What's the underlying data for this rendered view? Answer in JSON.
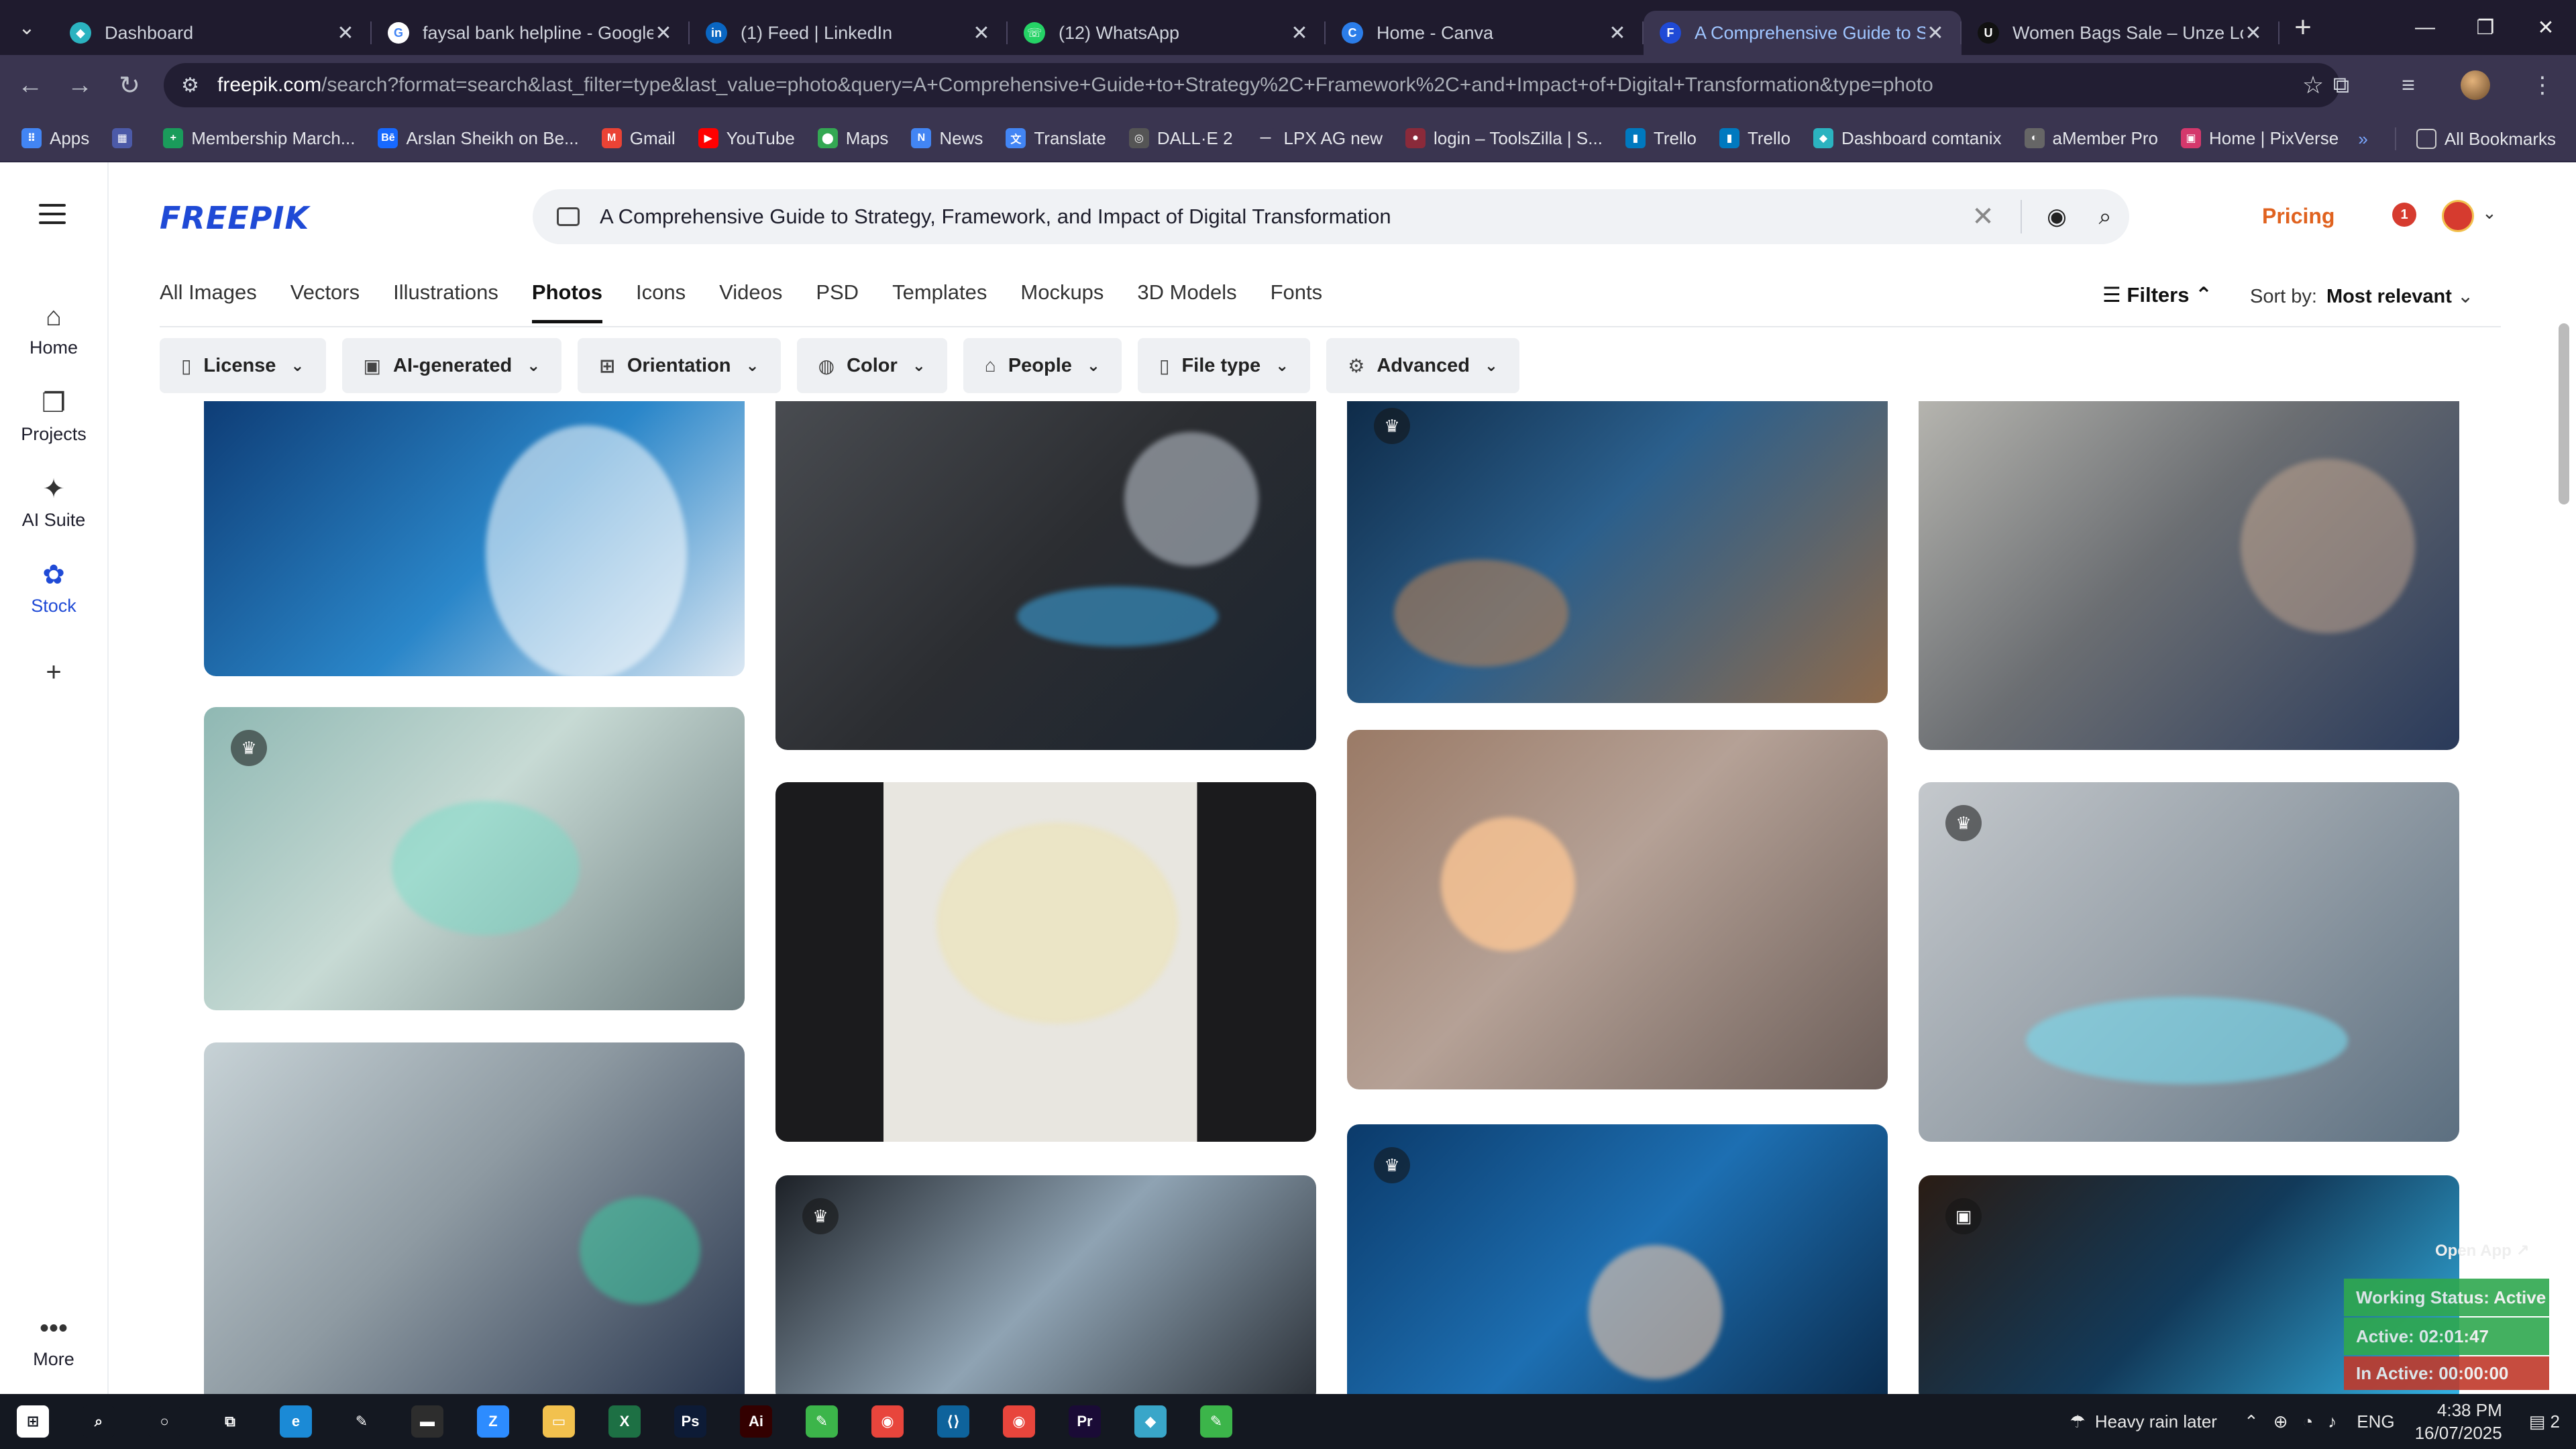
{
  "browser": {
    "tabs": [
      {
        "title": "Dashboard",
        "color": "#2bb3c0",
        "glyph": "◆"
      },
      {
        "title": "faysal bank helpline - Google S",
        "color": "#ffffff",
        "glyph": "G"
      },
      {
        "title": "(1) Feed | LinkedIn",
        "color": "#0a66c2",
        "glyph": "in"
      },
      {
        "title": "(12) WhatsApp",
        "color": "#25d366",
        "glyph": "☏"
      },
      {
        "title": "Home - Canva",
        "color": "#2b7de9",
        "glyph": "C"
      },
      {
        "title": "A Comprehensive Guide to Stra",
        "color": "#1f4ad6",
        "glyph": "F"
      },
      {
        "title": "Women Bags Sale – Unze Lond",
        "color": "#111111",
        "glyph": "U"
      }
    ],
    "url_host": "freepik.com",
    "url_rest": "/search?format=search&last_filter=type&last_value=photo&query=A+Comprehensive+Guide+to+Strategy%2C+Framework%2C+and+Impact+of+Digital+Transformation&type=photo",
    "bookmarks": [
      {
        "label": "Apps",
        "color": "#4285f4",
        "glyph": "⠿"
      },
      {
        "label": "",
        "color": "#4c5aa8",
        "glyph": "▦"
      },
      {
        "label": "Membership March...",
        "color": "#1a9c5b",
        "glyph": "+"
      },
      {
        "label": "Arslan Sheikh on Be...",
        "color": "#1769ff",
        "glyph": "Bē"
      },
      {
        "label": "Gmail",
        "color": "#ea4335",
        "glyph": "M"
      },
      {
        "label": "YouTube",
        "color": "#ff0000",
        "glyph": "▶"
      },
      {
        "label": "Maps",
        "color": "#34a853",
        "glyph": "⬤"
      },
      {
        "label": "News",
        "color": "#4285f4",
        "glyph": "N"
      },
      {
        "label": "Translate",
        "color": "#4285f4",
        "glyph": "文"
      },
      {
        "label": "DALL·E 2",
        "color": "#555555",
        "glyph": "◎"
      },
      {
        "label": "LPX AG new",
        "color": "#3a3550",
        "glyph": "—"
      },
      {
        "label": "login – ToolsZilla | S...",
        "color": "#8a2a3a",
        "glyph": "●"
      },
      {
        "label": "Trello",
        "color": "#0079bf",
        "glyph": "▮"
      },
      {
        "label": "Trello",
        "color": "#0079bf",
        "glyph": "▮"
      },
      {
        "label": "Dashboard comtanix",
        "color": "#2bb3c0",
        "glyph": "◆"
      },
      {
        "label": "aMember Pro",
        "color": "#666666",
        "glyph": "◐"
      },
      {
        "label": "Home | PixVerse",
        "color": "#d4386c",
        "glyph": "▣"
      }
    ],
    "all_bookmarks": "All Bookmarks"
  },
  "freepik": {
    "logo": "FREEPIK",
    "search_query": "A Comprehensive Guide to Strategy, Framework, and Impact of Digital Transformation",
    "pricing": "Pricing",
    "notif_count": "1",
    "nav": [
      {
        "label": "Home",
        "icon": "⌂"
      },
      {
        "label": "Projects",
        "icon": "❐"
      },
      {
        "label": "AI Suite",
        "icon": "✦"
      },
      {
        "label": "Stock",
        "icon": "✿"
      },
      {
        "label": "",
        "icon": "+"
      },
      {
        "label": "More",
        "icon": "•••"
      }
    ],
    "categories": [
      "All Images",
      "Vectors",
      "Illustrations",
      "Photos",
      "Icons",
      "Videos",
      "PSD",
      "Templates",
      "Mockups",
      "3D Models",
      "Fonts"
    ],
    "active_category": "Photos",
    "filters_label": "Filters",
    "sort_label": "Sort by:",
    "sort_value": "Most relevant",
    "chips": [
      {
        "label": "License",
        "icon": "▯"
      },
      {
        "label": "AI-generated",
        "icon": "▣"
      },
      {
        "label": "Orientation",
        "icon": "⊞"
      },
      {
        "label": "Color",
        "icon": "◍"
      },
      {
        "label": "People",
        "icon": "⌂"
      },
      {
        "label": "File type",
        "icon": "▯"
      },
      {
        "label": "Advanced",
        "icon": "⚙"
      }
    ]
  },
  "overlay": {
    "open_app": "Open App ↗",
    "status": "Working Status: Active",
    "active": "Active: 02:01:47",
    "inactive": "In Active: 00:00:00",
    "status_color": "#2fa84f",
    "inactive_color": "#c0392b"
  },
  "taskbar": {
    "weather": "Heavy rain later",
    "lang": "ENG",
    "time": "4:38 PM",
    "date": "16/07/2025",
    "notif": "2",
    "apps": [
      {
        "name": "windows",
        "color": "#ffffff",
        "glyph": "⊞"
      },
      {
        "name": "search",
        "color": "#141821",
        "glyph": "⌕"
      },
      {
        "name": "cortana",
        "color": "#141821",
        "glyph": "○"
      },
      {
        "name": "taskview",
        "color": "#141821",
        "glyph": "⧉"
      },
      {
        "name": "edge",
        "color": "#1b8ad6",
        "glyph": "e"
      },
      {
        "name": "pen",
        "color": "#141821",
        "glyph": "✎"
      },
      {
        "name": "terminal",
        "color": "#2d2d2d",
        "glyph": "▬"
      },
      {
        "name": "zoom",
        "color": "#2d8cff",
        "glyph": "Z"
      },
      {
        "name": "explorer",
        "color": "#f2c14e",
        "glyph": "▭"
      },
      {
        "name": "excel",
        "color": "#1d7044",
        "glyph": "X"
      },
      {
        "name": "photoshop",
        "color": "#0d1b36",
        "glyph": "Ps"
      },
      {
        "name": "illustrator",
        "color": "#330000",
        "glyph": "Ai"
      },
      {
        "name": "app-green",
        "color": "#3cb54a",
        "glyph": "✎"
      },
      {
        "name": "chrome",
        "color": "#e8453c",
        "glyph": "◉"
      },
      {
        "name": "vscode",
        "color": "#0e639c",
        "glyph": "⟨⟩"
      },
      {
        "name": "chrome-2",
        "color": "#e8453c",
        "glyph": "◉"
      },
      {
        "name": "premiere",
        "color": "#1a0b36",
        "glyph": "Pr"
      },
      {
        "name": "app-teal",
        "color": "#39a6c9",
        "glyph": "◆"
      },
      {
        "name": "app-green-2",
        "color": "#3cb54a",
        "glyph": "✎"
      }
    ]
  }
}
